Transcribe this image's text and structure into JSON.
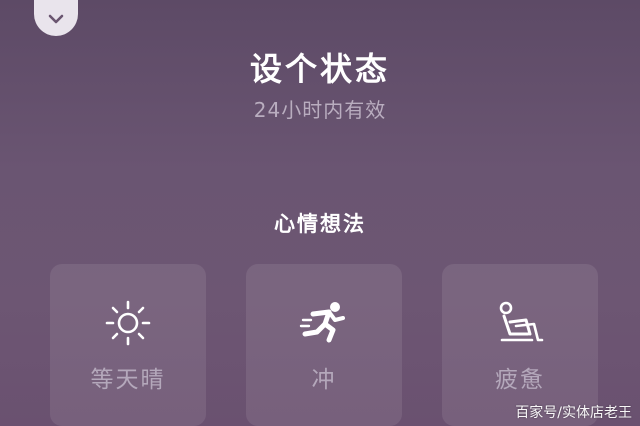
{
  "header": {
    "collapse_icon": "chevron-down-icon",
    "title": "设个状态",
    "subtitle": "24小时内有效"
  },
  "section": {
    "label": "心情想法"
  },
  "statuses": [
    {
      "label": "等天晴",
      "icon": "sun-icon"
    },
    {
      "label": "冲",
      "icon": "running-icon"
    },
    {
      "label": "疲惫",
      "icon": "tired-icon"
    }
  ],
  "watermark": "百家号/实体店老王",
  "colors": {
    "background": "#6a5572",
    "card": "rgba(255,255,255,0.09)",
    "muted_text": "#b4a8bb"
  }
}
